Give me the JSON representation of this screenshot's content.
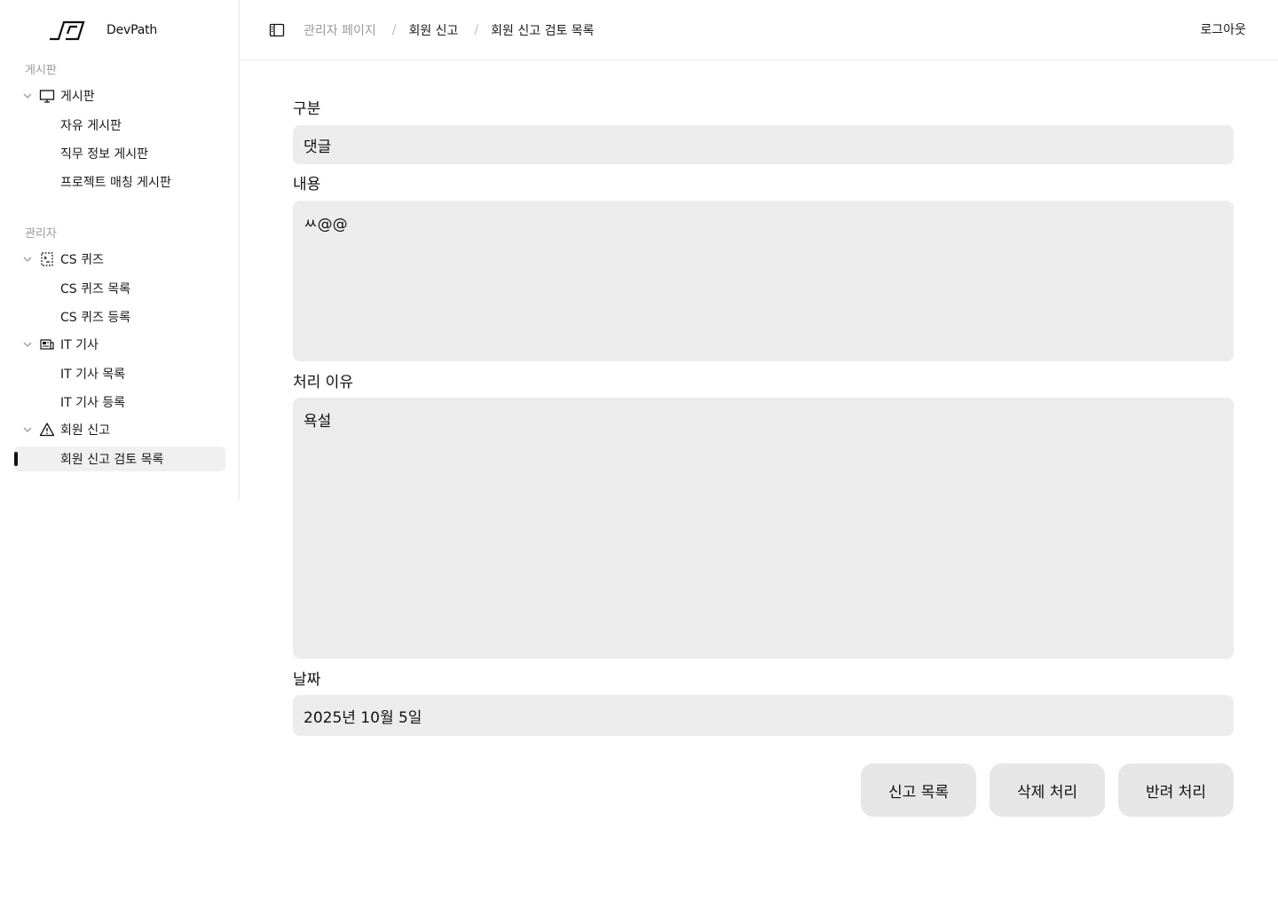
{
  "brand": {
    "name": "DevPath"
  },
  "sidebar": {
    "sections": [
      {
        "label": "게시판",
        "groups": [
          {
            "label": "게시판",
            "icon": "monitor-icon",
            "items": [
              "자유 게시판",
              "직무 정보 게시판",
              "프로젝트 매칭 게시판"
            ]
          }
        ]
      },
      {
        "label": "관리자",
        "groups": [
          {
            "label": "CS 퀴즈",
            "icon": "quiz-icon",
            "items": [
              "CS 퀴즈 목록",
              "CS 퀴즈 등록"
            ]
          },
          {
            "label": "IT 기사",
            "icon": "newspaper-icon",
            "items": [
              "IT 기사 목록",
              "IT 기사 등록"
            ]
          },
          {
            "label": "회원 신고",
            "icon": "warning-icon",
            "items": [
              "회원 신고 검토 목록"
            ]
          }
        ]
      }
    ],
    "active_item": "회원 신고 검토 목록"
  },
  "header": {
    "breadcrumb": [
      "관리자 페이지",
      "회원 신고",
      "회원 신고 검토 목록"
    ],
    "separator": "/",
    "logout_label": "로그아웃"
  },
  "form": {
    "type_label": "구분",
    "type_value": "댓글",
    "content_label": "내용",
    "content_value": "ㅆ@@",
    "reason_label": "처리 이유",
    "reason_value": "욕설",
    "date_label": "날짜",
    "date_value": "2025년 10월 5일"
  },
  "actions": {
    "list_label": "신고 목록",
    "delete_label": "삭제 처리",
    "reject_label": "반려 처리"
  }
}
